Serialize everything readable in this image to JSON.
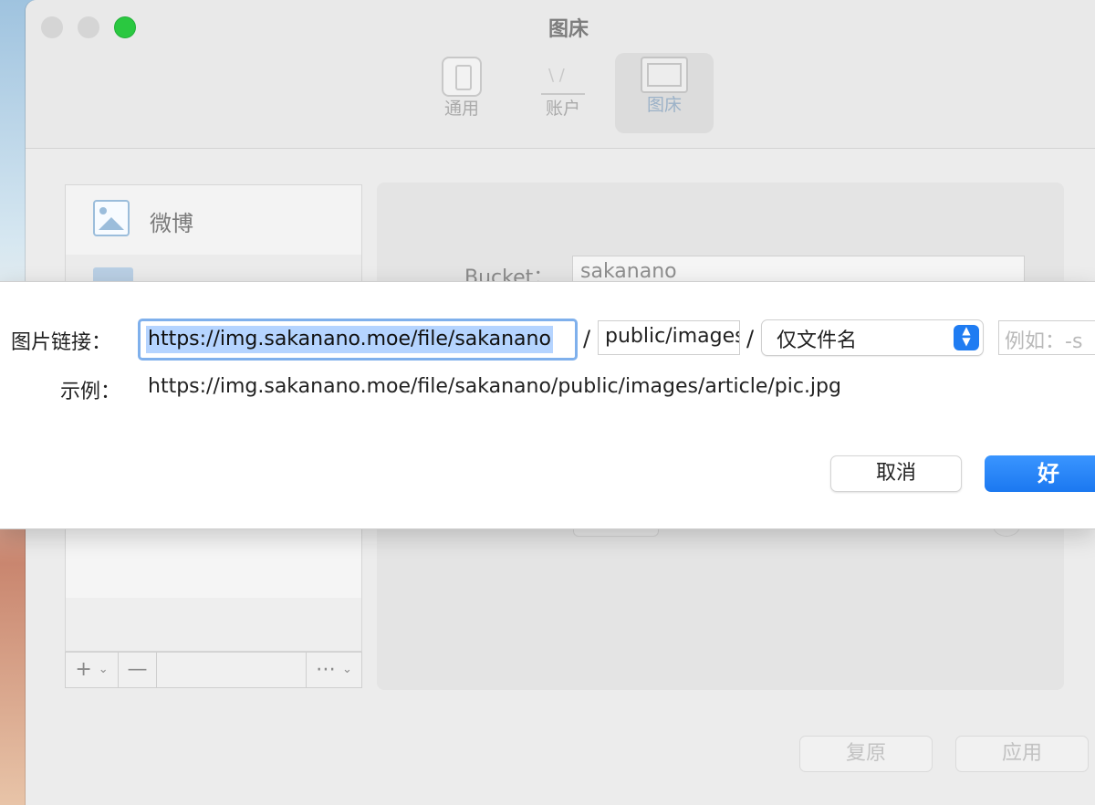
{
  "window": {
    "title": "图床"
  },
  "toolbar": {
    "items": [
      {
        "label": "通用",
        "icon": "phone-icon"
      },
      {
        "label": "账户",
        "icon": "account-icon"
      },
      {
        "label": "图床",
        "icon": "image-gallery-icon"
      }
    ],
    "active": "图床"
  },
  "sidebar": {
    "items": [
      {
        "label": "微博",
        "icon": "image-icon"
      },
      {
        "label": "",
        "icon": "mail-icon"
      }
    ],
    "controls": {
      "add": "+",
      "remove": "—",
      "more": "⋯"
    }
  },
  "detail": {
    "bucket_label": "Bucket：",
    "bucket_value": "sakanano"
  },
  "footer": {
    "reset_label": "复原",
    "apply_label": "应用"
  },
  "sheet": {
    "link_label": "图片链接：",
    "base_url": "https://img.sakanano.moe/file/sakanano",
    "separator": "/",
    "path_value": "public/images",
    "naming_select": "仅文件名",
    "example_placeholder": "例如：-s",
    "example_label": "示例：",
    "example_url": "https://img.sakanano.moe/file/sakanano/public/images/article/pic.jpg",
    "cancel_label": "取消",
    "ok_label": "好"
  },
  "colors": {
    "accent": "#1f7cf2",
    "selection": "#b5d4ff",
    "traffic_green": "#2ac840"
  }
}
